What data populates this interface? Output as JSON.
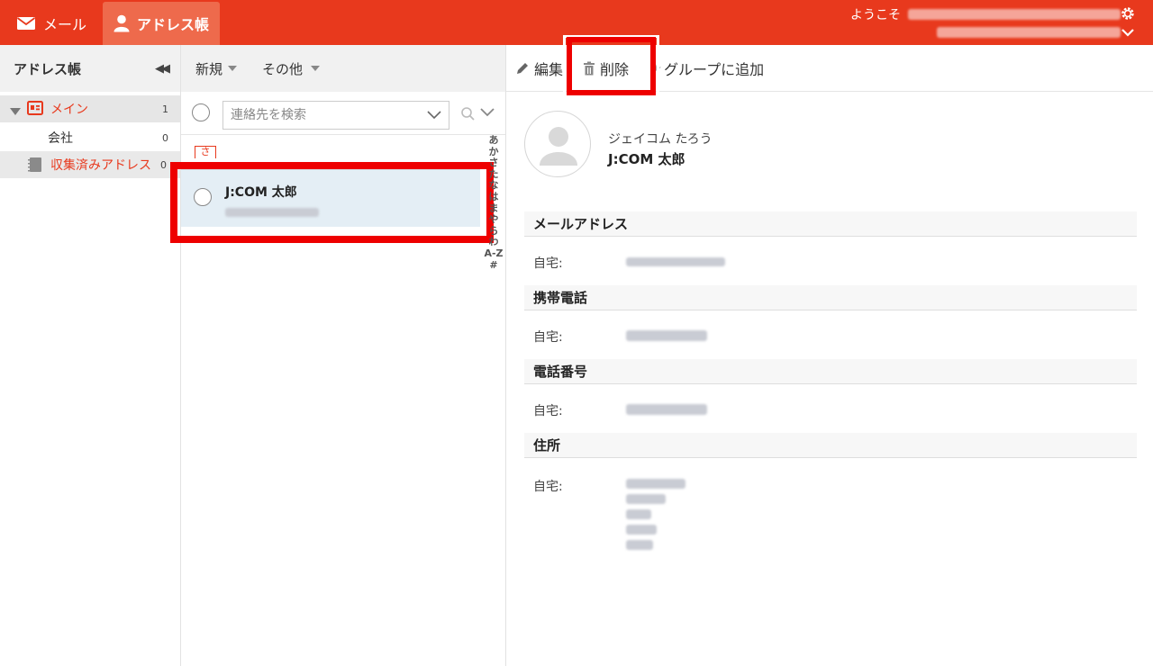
{
  "topbar": {
    "mail_tab": "メール",
    "address_tab": "アドレス帳",
    "welcome": "ようこそ"
  },
  "sidebar": {
    "title": "アドレス帳",
    "items": [
      {
        "label": "メイン",
        "count": "1"
      },
      {
        "label": "会社",
        "count": "0"
      },
      {
        "label": "収集済みアドレス",
        "count": "0"
      }
    ]
  },
  "list": {
    "toolbar": {
      "new_label": "新規",
      "other_label": "その他"
    },
    "search_placeholder": "連絡先を検索",
    "index_letter": "さ",
    "contact": {
      "name": "J:COM 太郎"
    },
    "index_bar": [
      "あ",
      "か",
      "さ",
      "た",
      "な",
      "は",
      "ま",
      "や",
      "ら",
      "わ",
      "A-Z",
      "#"
    ]
  },
  "detail": {
    "toolbar": {
      "edit_label": "編集",
      "delete_label": "削除",
      "add_group_label": "グループに追加"
    },
    "kana": "ジェイコム たろう",
    "name": "J:COM 太郎",
    "sections": {
      "email": {
        "title": "メールアドレス",
        "label": "自宅:"
      },
      "mobile": {
        "title": "携帯電話",
        "label": "自宅:"
      },
      "phone": {
        "title": "電話番号",
        "label": "自宅:"
      },
      "address": {
        "title": "住所",
        "label": "自宅:"
      }
    }
  },
  "colors": {
    "brand": "#e8391d",
    "highlight": "#ee0000",
    "selected_row": "#e4eef5"
  }
}
